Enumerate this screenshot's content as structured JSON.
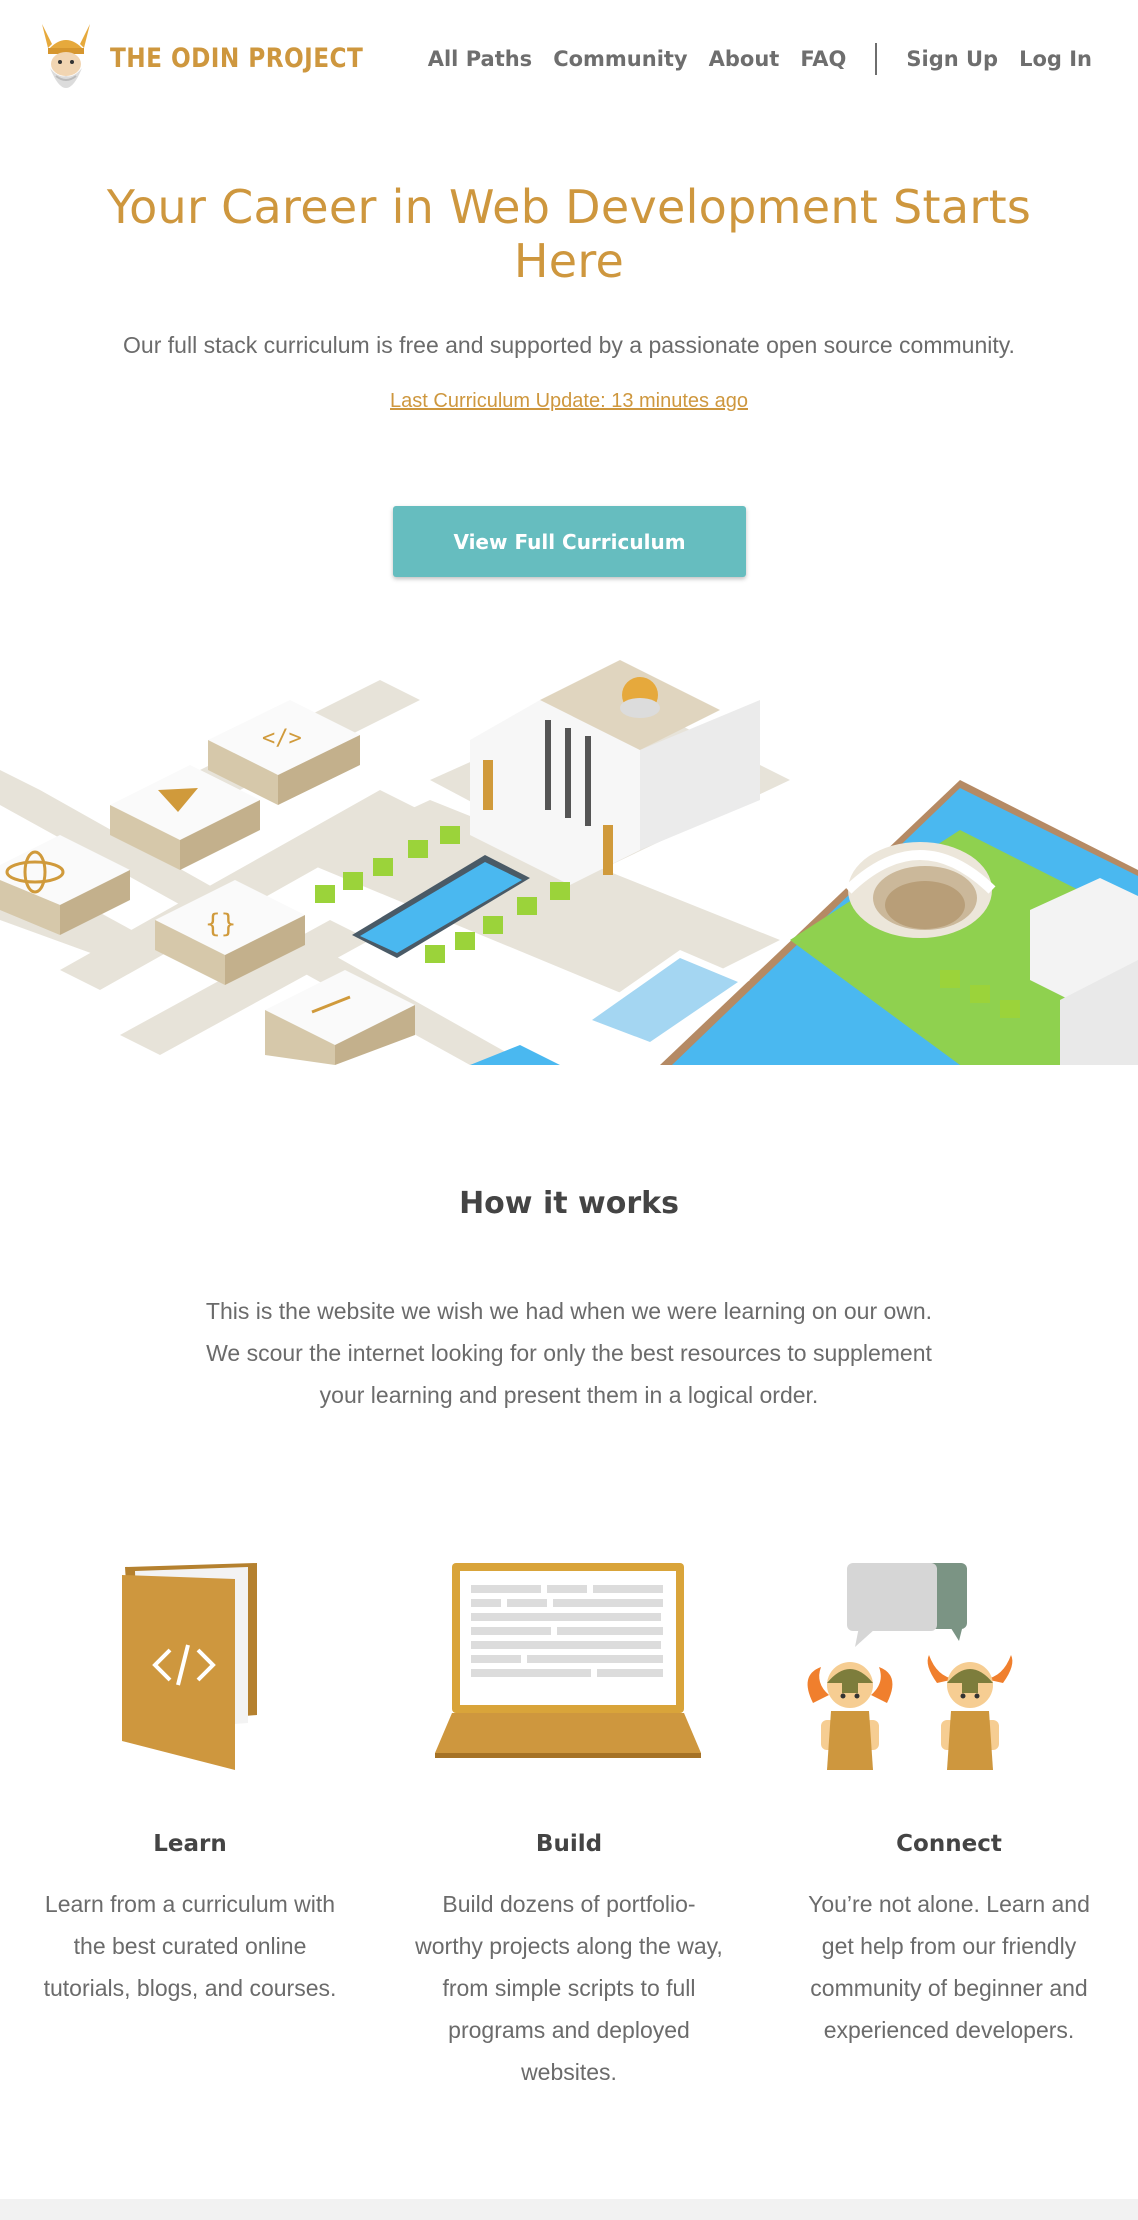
{
  "nav": {
    "logo_text": "THE ODIN PROJECT",
    "links": [
      "All Paths",
      "Community",
      "About",
      "FAQ"
    ],
    "auth": [
      "Sign Up",
      "Log In"
    ]
  },
  "hero": {
    "title_line1": "Your Career in Web Development Starts",
    "title_line2": "Here",
    "subtitle": "Our full stack curriculum is free and supported by a passionate open source community.",
    "update_link": "Last Curriculum Update: 13 minutes ago",
    "cta_label": "View Full Curriculum"
  },
  "how_it_works": {
    "title": "How it works",
    "text": "This is the website we wish we had when we were learning on our own. We scour the internet looking for only the best resources to supplement your learning and present them in a logical order.",
    "features": [
      {
        "title": "Learn",
        "text": "Learn from a curriculum with the best curated online tutorials, blogs, and courses."
      },
      {
        "title": "Build",
        "text": "Build dozens of portfolio-worthy projects along the way, from simple scripts to full programs and deployed websites."
      },
      {
        "title": "Connect",
        "text": "You’re not alone. Learn and get help from our friendly community of beginner and experienced developers."
      }
    ]
  },
  "colors": {
    "brand": "#ce973e",
    "cta": "#66bdbf",
    "water": "#4ab8f0",
    "grass": "#8fd14f"
  },
  "icons": [
    "odin-logo-icon",
    "book-code-icon",
    "laptop-icon",
    "community-vikings-icon"
  ]
}
